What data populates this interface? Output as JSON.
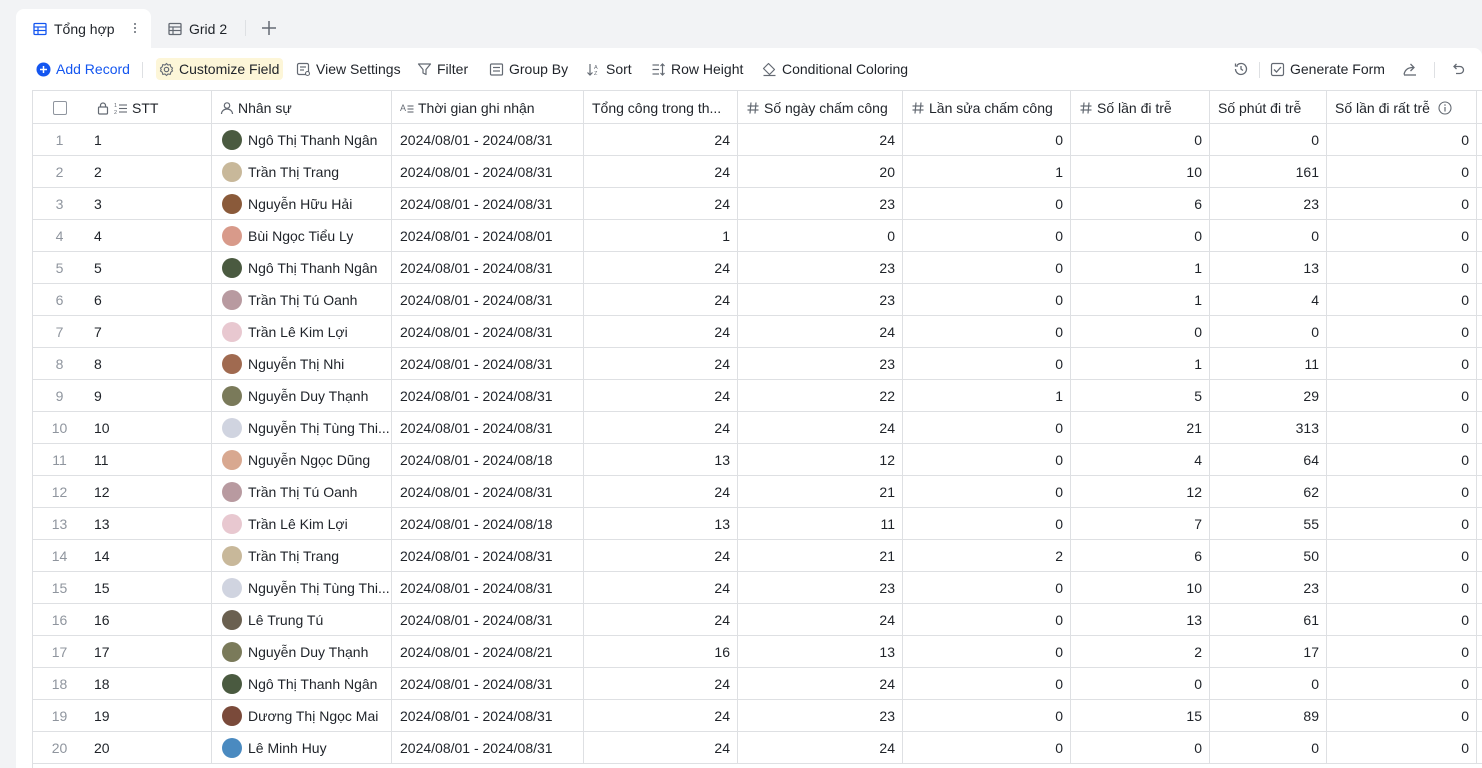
{
  "tabs": [
    {
      "label": "Tổng hợp",
      "active": true
    },
    {
      "label": "Grid 2",
      "active": false
    }
  ],
  "toolbar": {
    "add_record": "Add Record",
    "customize_field": "Customize Field",
    "view_settings": "View Settings",
    "filter": "Filter",
    "group_by": "Group By",
    "sort": "Sort",
    "row_height": "Row Height",
    "conditional_coloring": "Conditional Coloring",
    "generate_form": "Generate Form"
  },
  "colors": {
    "accent": "#1456f0",
    "highlight": "#fdf6d8",
    "border": "#dee0e3",
    "muted": "#8f959e"
  },
  "columns": [
    {
      "label": "STT",
      "icon": "autonumber-icon"
    },
    {
      "label": "Nhân sự",
      "icon": "person-icon"
    },
    {
      "label": "Thời gian ghi nhận",
      "icon": "text-icon"
    },
    {
      "label": "Tổng công trong th...",
      "icon": ""
    },
    {
      "label": "Số ngày chấm công",
      "icon": "number-icon"
    },
    {
      "label": "Lần sửa chấm công",
      "icon": "number-icon"
    },
    {
      "label": "Số lần đi trễ",
      "icon": "number-icon"
    },
    {
      "label": "Số phút đi trễ",
      "icon": ""
    },
    {
      "label": "Số lần đi rất trễ",
      "icon": "info-icon"
    }
  ],
  "rows": [
    {
      "idx": "1",
      "stt": "1",
      "name": "Ngô Thị Thanh Ngân",
      "avatar": "#4a5a40",
      "period": "2024/08/01 - 2024/08/31",
      "total": "24",
      "days": "24",
      "edits": "0",
      "late": "0",
      "minutes": "0",
      "very_late": "0"
    },
    {
      "idx": "2",
      "stt": "2",
      "name": "Trần Thị Trang",
      "avatar": "#c8b89a",
      "period": "2024/08/01 - 2024/08/31",
      "total": "24",
      "days": "20",
      "edits": "1",
      "late": "10",
      "minutes": "161",
      "very_late": "0"
    },
    {
      "idx": "3",
      "stt": "3",
      "name": "Nguyễn Hữu Hải",
      "avatar": "#8a5a3a",
      "period": "2024/08/01 - 2024/08/31",
      "total": "24",
      "days": "23",
      "edits": "0",
      "late": "6",
      "minutes": "23",
      "very_late": "0"
    },
    {
      "idx": "4",
      "stt": "4",
      "name": "Bùi Ngọc Tiểu Ly",
      "avatar": "#d89a8a",
      "period": "2024/08/01 - 2024/08/01",
      "total": "1",
      "days": "0",
      "edits": "0",
      "late": "0",
      "minutes": "0",
      "very_late": "0"
    },
    {
      "idx": "5",
      "stt": "5",
      "name": "Ngô Thị Thanh Ngân",
      "avatar": "#4a5a40",
      "period": "2024/08/01 - 2024/08/31",
      "total": "24",
      "days": "23",
      "edits": "0",
      "late": "1",
      "minutes": "13",
      "very_late": "0"
    },
    {
      "idx": "6",
      "stt": "6",
      "name": "Trần Thị Tú Oanh",
      "avatar": "#b89aa0",
      "period": "2024/08/01 - 2024/08/31",
      "total": "24",
      "days": "23",
      "edits": "0",
      "late": "1",
      "minutes": "4",
      "very_late": "0"
    },
    {
      "idx": "7",
      "stt": "7",
      "name": "Trần Lê Kim Lợi",
      "avatar": "#e8c8d0",
      "period": "2024/08/01 - 2024/08/31",
      "total": "24",
      "days": "24",
      "edits": "0",
      "late": "0",
      "minutes": "0",
      "very_late": "0"
    },
    {
      "idx": "8",
      "stt": "8",
      "name": "Nguyễn Thị  Nhi",
      "avatar": "#a06a50",
      "period": "2024/08/01 - 2024/08/31",
      "total": "24",
      "days": "23",
      "edits": "0",
      "late": "1",
      "minutes": "11",
      "very_late": "0"
    },
    {
      "idx": "9",
      "stt": "9",
      "name": "Nguyễn Duy Thạnh",
      "avatar": "#7a7a5a",
      "period": "2024/08/01 - 2024/08/31",
      "total": "24",
      "days": "22",
      "edits": "1",
      "late": "5",
      "minutes": "29",
      "very_late": "0"
    },
    {
      "idx": "10",
      "stt": "10",
      "name": "Nguyễn Thị Tùng Thi...",
      "avatar": "#d0d4e0",
      "period": "2024/08/01 - 2024/08/31",
      "total": "24",
      "days": "24",
      "edits": "0",
      "late": "21",
      "minutes": "313",
      "very_late": "0"
    },
    {
      "idx": "11",
      "stt": "11",
      "name": "Nguyễn Ngọc Dũng",
      "avatar": "#d8a890",
      "period": "2024/08/01 - 2024/08/18",
      "total": "13",
      "days": "12",
      "edits": "0",
      "late": "4",
      "minutes": "64",
      "very_late": "0"
    },
    {
      "idx": "12",
      "stt": "12",
      "name": "Trần Thị Tú Oanh",
      "avatar": "#b89aa0",
      "period": "2024/08/01 - 2024/08/31",
      "total": "24",
      "days": "21",
      "edits": "0",
      "late": "12",
      "minutes": "62",
      "very_late": "0"
    },
    {
      "idx": "13",
      "stt": "13",
      "name": "Trần Lê Kim Lợi",
      "avatar": "#e8c8d0",
      "period": "2024/08/01 - 2024/08/18",
      "total": "13",
      "days": "11",
      "edits": "0",
      "late": "7",
      "minutes": "55",
      "very_late": "0"
    },
    {
      "idx": "14",
      "stt": "14",
      "name": "Trần Thị Trang",
      "avatar": "#c8b89a",
      "period": "2024/08/01 - 2024/08/31",
      "total": "24",
      "days": "21",
      "edits": "2",
      "late": "6",
      "minutes": "50",
      "very_late": "0"
    },
    {
      "idx": "15",
      "stt": "15",
      "name": "Nguyễn Thị Tùng Thi...",
      "avatar": "#d0d4e0",
      "period": "2024/08/01 - 2024/08/31",
      "total": "24",
      "days": "23",
      "edits": "0",
      "late": "10",
      "minutes": "23",
      "very_late": "0"
    },
    {
      "idx": "16",
      "stt": "16",
      "name": "Lê Trung Tú",
      "avatar": "#6a6050",
      "period": "2024/08/01 - 2024/08/31",
      "total": "24",
      "days": "24",
      "edits": "0",
      "late": "13",
      "minutes": "61",
      "very_late": "0"
    },
    {
      "idx": "17",
      "stt": "17",
      "name": "Nguyễn Duy Thạnh",
      "avatar": "#7a7a5a",
      "period": "2024/08/01 - 2024/08/21",
      "total": "16",
      "days": "13",
      "edits": "0",
      "late": "2",
      "minutes": "17",
      "very_late": "0"
    },
    {
      "idx": "18",
      "stt": "18",
      "name": "Ngô Thị Thanh Ngân",
      "avatar": "#4a5a40",
      "period": "2024/08/01 - 2024/08/31",
      "total": "24",
      "days": "24",
      "edits": "0",
      "late": "0",
      "minutes": "0",
      "very_late": "0"
    },
    {
      "idx": "19",
      "stt": "19",
      "name": "Dương Thị Ngọc Mai",
      "avatar": "#7a4a3a",
      "period": "2024/08/01 - 2024/08/31",
      "total": "24",
      "days": "23",
      "edits": "0",
      "late": "15",
      "minutes": "89",
      "very_late": "0"
    },
    {
      "idx": "20",
      "stt": "20",
      "name": "Lê Minh Huy",
      "avatar": "#4a8ac0",
      "period": "2024/08/01 - 2024/08/31",
      "total": "24",
      "days": "24",
      "edits": "0",
      "late": "0",
      "minutes": "0",
      "very_late": "0"
    }
  ]
}
